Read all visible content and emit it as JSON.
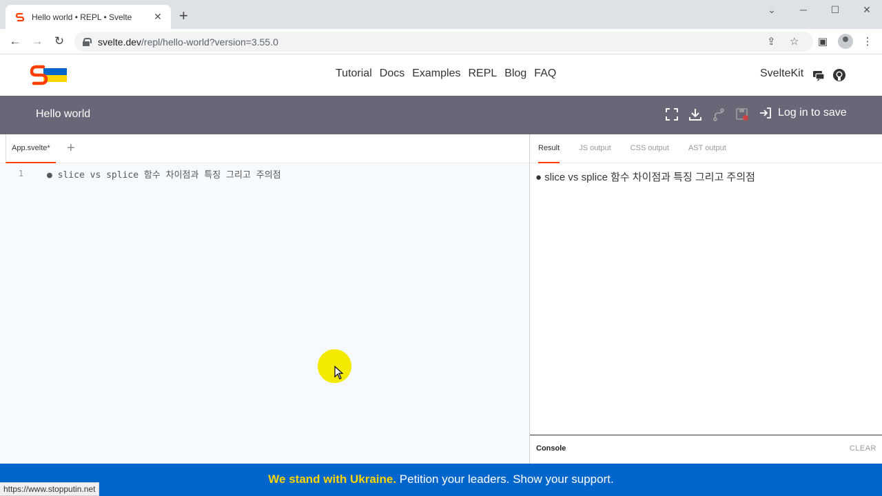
{
  "browser": {
    "tab_title": "Hello world • REPL • Svelte",
    "tab_close": "✕",
    "new_tab": "+",
    "url_host": "svelte.dev",
    "url_rest": "/repl/hello-world?version=3.55.0",
    "status_url": "https://www.stopputin.net",
    "icons": {
      "back": "←",
      "forward": "→",
      "reload": "↻",
      "share": "⇪",
      "star": "☆",
      "sidebar": "▣",
      "menu": "⋮",
      "minimize": "─",
      "maximize": "☐",
      "close": "✕",
      "tab_search": "⌄"
    }
  },
  "site_nav": {
    "links": [
      "Tutorial",
      "Docs",
      "Examples",
      "REPL",
      "Blog",
      "FAQ"
    ],
    "sveltekit": "SvelteKit"
  },
  "repl": {
    "title": "Hello world",
    "login": "Log in to save",
    "file_tab": "App.svelte*",
    "add_file": "+",
    "code_lines": [
      {
        "number": "1",
        "text": "● slice vs splice 함수 차이점과 특징 그리고 주의점"
      }
    ],
    "output_tabs": [
      "Result",
      "JS output",
      "CSS output",
      "AST output"
    ],
    "active_output_tab": "Result",
    "result_text": "● slice vs splice 함수 차이점과 특징 그리고 주의점",
    "console_label": "Console",
    "console_clear": "CLEAR"
  },
  "banner": {
    "strong": "We stand with Ukraine.",
    "rest": " Petition your leaders. Show your support."
  },
  "colors": {
    "svelte_orange": "#ff3e00",
    "app_bar": "#676778",
    "banner_blue": "#0066cc",
    "banner_yellow": "#ffd500",
    "editor_bg": "#f6fafd"
  }
}
